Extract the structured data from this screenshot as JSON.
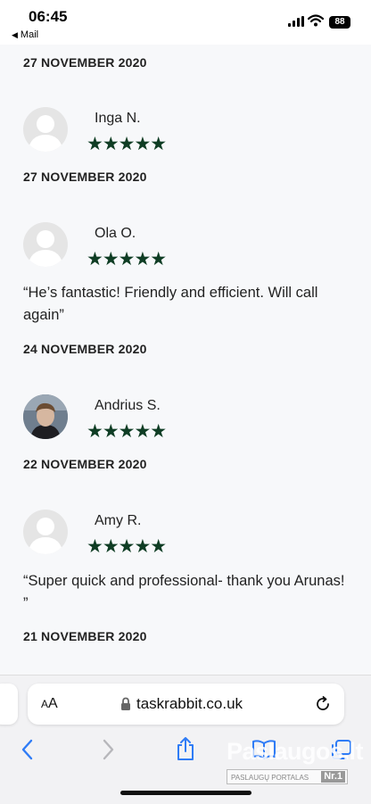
{
  "status": {
    "time": "06:45",
    "back_app": "Mail",
    "battery": "88"
  },
  "reviews": [
    {
      "date": "27 NOVEMBER 2020"
    },
    {
      "name": "Inga N.",
      "stars": "★★★★★",
      "date": "27 NOVEMBER 2020",
      "comment": ""
    },
    {
      "name": "Ola O.",
      "stars": "★★★★★",
      "date": "24 NOVEMBER 2020",
      "comment": "“He’s fantastic! Friendly and efficient. Will call again”"
    },
    {
      "name": "Andrius S.",
      "stars": "★★★★★",
      "date": "22 NOVEMBER 2020",
      "comment": ""
    },
    {
      "name": "Amy R.",
      "stars": "★★★★★",
      "date": "21 NOVEMBER 2020",
      "comment": "“Super quick and professional- thank you Arunas! ”"
    }
  ],
  "browser": {
    "aa_small": "A",
    "aa_big": "A",
    "url": "taskrabbit.co.uk"
  },
  "watermark": {
    "brand": "Paslaugos.lt",
    "subtitle": "PASLAUGŲ PORTALAS",
    "badge": "Nr.1"
  },
  "colors": {
    "star": "#0f3d24",
    "background": "#f7f8fa",
    "accent": "#2f7cf6"
  }
}
